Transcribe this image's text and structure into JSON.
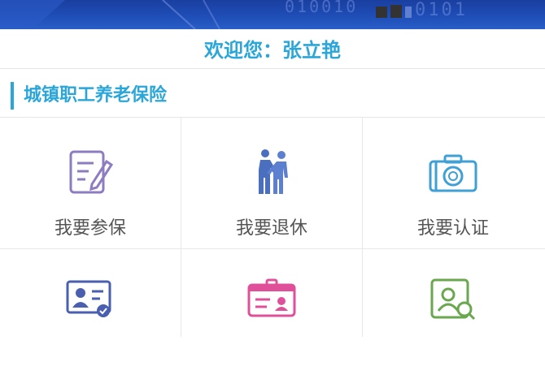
{
  "header": {
    "welcome": "欢迎您：张立艳"
  },
  "section": {
    "title": "城镇职工养老保险"
  },
  "tiles": [
    {
      "label": "我要参保",
      "icon": "edit-form-icon"
    },
    {
      "label": "我要退休",
      "icon": "handshake-icon"
    },
    {
      "label": "我要认证",
      "icon": "camera-icon"
    },
    {
      "label": "",
      "icon": "id-card-icon"
    },
    {
      "label": "",
      "icon": "badge-card-icon"
    },
    {
      "label": "",
      "icon": "person-search-icon"
    }
  ],
  "colors": {
    "accent": "#2aa6d8",
    "banner": "#1f4fb8"
  }
}
